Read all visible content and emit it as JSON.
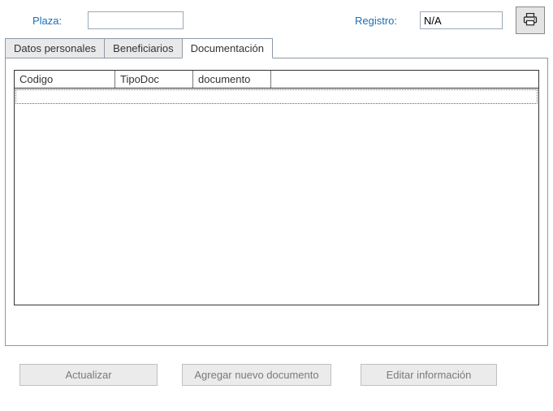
{
  "header": {
    "plaza_label": "Plaza:",
    "plaza_value": "",
    "registro_label": "Registro:",
    "registro_value": "N/A"
  },
  "tabs": {
    "personal": "Datos personales",
    "beneficiarios": "Beneficiarios",
    "documentacion": "Documentación",
    "active": "documentacion"
  },
  "grid": {
    "columns": {
      "codigo": "Codigo",
      "tipodoc": "TipoDoc",
      "documento": "documento"
    },
    "rows": []
  },
  "buttons": {
    "actualizar": "Actualizar",
    "agregar": "Agregar nuevo documento",
    "editar": "Editar información"
  }
}
